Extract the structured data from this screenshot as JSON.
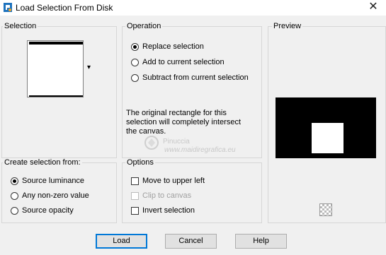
{
  "window": {
    "title": "Load Selection From Disk",
    "close_glyph": "✕"
  },
  "selection": {
    "label": "Selection",
    "dropdown_glyph": "▾"
  },
  "operation": {
    "label": "Operation",
    "options": [
      {
        "label": "Replace selection",
        "checked": true
      },
      {
        "label": "Add to current selection",
        "checked": false
      },
      {
        "label": "Subtract from current selection",
        "checked": false
      }
    ],
    "note_lines": [
      "The original rectangle for this",
      "selection will completely intersect",
      "the canvas."
    ]
  },
  "preview": {
    "label": "Preview"
  },
  "create_from": {
    "label": "Create selection from:",
    "options": [
      {
        "label": "Source luminance",
        "checked": true
      },
      {
        "label": "Any non-zero value",
        "checked": false
      },
      {
        "label": "Source opacity",
        "checked": false
      }
    ]
  },
  "options": {
    "label": "Options",
    "items": [
      {
        "label": "Move to upper left",
        "checked": false,
        "enabled": true
      },
      {
        "label": "Clip to canvas",
        "checked": false,
        "enabled": false
      },
      {
        "label": "Invert selection",
        "checked": false,
        "enabled": true
      }
    ]
  },
  "watermark": {
    "line1": "Pinuccia",
    "line2": "www.maidiregrafica.eu"
  },
  "buttons": {
    "load": "Load",
    "cancel": "Cancel",
    "help": "Help"
  }
}
